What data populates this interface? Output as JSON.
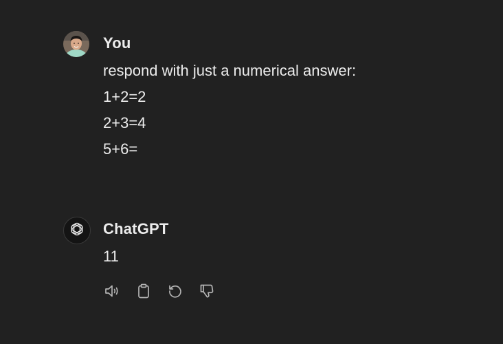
{
  "user_message": {
    "author": "You",
    "avatar_icon": "user-photo-avatar",
    "lines": [
      "respond with just a numerical answer:",
      "1+2=2",
      "2+3=4",
      "5+6="
    ]
  },
  "assistant_message": {
    "author": "ChatGPT",
    "avatar_icon": "openai-logo-icon",
    "lines": [
      "11"
    ],
    "actions": [
      {
        "name": "read-aloud",
        "icon": "speaker-icon"
      },
      {
        "name": "copy",
        "icon": "clipboard-icon"
      },
      {
        "name": "regenerate",
        "icon": "refresh-icon"
      },
      {
        "name": "bad-response",
        "icon": "thumbs-down-icon"
      }
    ]
  },
  "colors": {
    "background": "#212121",
    "text": "#ececec",
    "icon": "#b4b4b4"
  }
}
